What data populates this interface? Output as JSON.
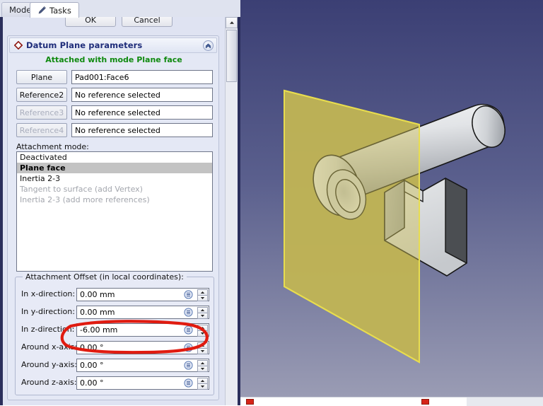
{
  "tabs": [
    {
      "label": "Model",
      "active": false
    },
    {
      "label": "Tasks",
      "active": true,
      "icon": "pencil-icon"
    }
  ],
  "dialog_buttons": {
    "ok": "OK",
    "cancel": "Cancel"
  },
  "panel": {
    "title": "Datum Plane parameters",
    "icon": "datum-plane-diamond-icon",
    "collapse_icon": "chevron-up-icon",
    "attached_note": "Attached with mode Plane face"
  },
  "references": [
    {
      "button": "Plane",
      "value": "Pad001:Face6",
      "disabled": false
    },
    {
      "button": "Reference2",
      "value": "No reference selected",
      "disabled": false
    },
    {
      "button": "Reference3",
      "value": "No reference selected",
      "disabled": true
    },
    {
      "button": "Reference4",
      "value": "No reference selected",
      "disabled": true
    }
  ],
  "attachment_mode": {
    "label": "Attachment mode:",
    "items": [
      {
        "text": "Deactivated",
        "selected": false,
        "disabled": false
      },
      {
        "text": "Plane face",
        "selected": true,
        "disabled": false
      },
      {
        "text": "Inertia 2-3",
        "selected": false,
        "disabled": false
      },
      {
        "text": "Tangent to surface (add Vertex)",
        "selected": false,
        "disabled": true
      },
      {
        "text": "Inertia 2-3 (add more references)",
        "selected": false,
        "disabled": true
      }
    ]
  },
  "attachment_offset": {
    "legend": "Attachment Offset (in local coordinates):",
    "fields": [
      {
        "label": "In x-direction:",
        "value": "0.00 mm",
        "highlighted": false
      },
      {
        "label": "In y-direction:",
        "value": "0.00 mm",
        "highlighted": false
      },
      {
        "label": "In z-direction:",
        "value": "-6.00 mm",
        "highlighted": true
      },
      {
        "label": "Around x-axis:",
        "value": "0.00 °",
        "highlighted": false
      },
      {
        "label": "Around y-axis:",
        "value": "0.00 °",
        "highlighted": false
      },
      {
        "label": "Around z-axis:",
        "value": "0.00 °",
        "highlighted": false
      }
    ],
    "expression_icon": "expression-editor-icon",
    "spinner_up_icon": "spinner-up-arrow-icon",
    "spinner_down_icon": "spinner-down-arrow-icon"
  },
  "scrollbar": {
    "up_arrow_icon": "scroll-up-arrow-icon",
    "thumb": "scroll-thumb"
  },
  "viewport": {
    "name": "3d-viewport",
    "background_top": "#3b3f74",
    "background_bottom": "#9a9cb4",
    "datum_plane_fill": "#b3a84f",
    "datum_plane_edge": "#e8dd4e",
    "solid_fill": "#d8dade",
    "solid_edge": "#1a1a1a"
  },
  "annotation": {
    "name": "red-highlight-ellipse",
    "color": "#e01b10",
    "target": "In z-direction field"
  }
}
